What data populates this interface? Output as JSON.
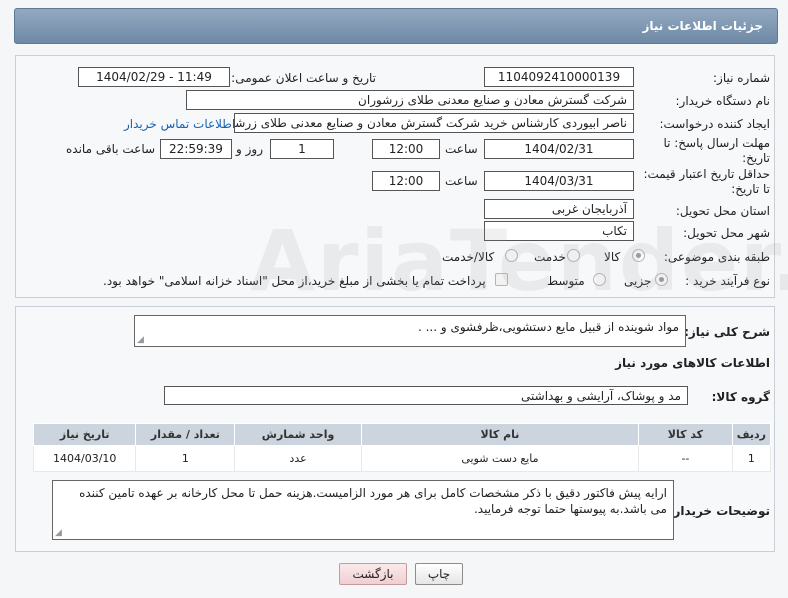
{
  "header": {
    "title": "جزئیات اطلاعات نیاز"
  },
  "need_number": {
    "label": "شماره نیاز:",
    "value": "1104092410000139"
  },
  "announce": {
    "label": "تاریخ و ساعت اعلان عمومی:",
    "value": "1404/02/29 - 11:49"
  },
  "buyer_org": {
    "label": "نام دستگاه خریدار:",
    "value": "شرکت گسترش معادن و صنایع معدنی طلای زرشوران"
  },
  "creator": {
    "label": "ایجاد کننده درخواست:",
    "value": "ناصر  ابیوردی  کارشناس خرید  شرکت گسترش معادن و صنایع معدنی طلای زرشوران",
    "contact_link": "اطلاعات تماس خریدار"
  },
  "reply_deadline": {
    "label_line1": "مهلت ارسال پاسخ: تا",
    "label_line2": "تاریخ:",
    "date": "1404/02/31",
    "time_label": "ساعت",
    "time": "12:00",
    "days": "1",
    "days_label": "روز و",
    "remaining": "22:59:39",
    "remaining_label": "ساعت باقی مانده"
  },
  "price_validity": {
    "label_line1": "حداقل تاریخ اعتبار قیمت:",
    "label_line2": "تا تاریخ:",
    "date": "1404/03/31",
    "time_label": "ساعت",
    "time": "12:00"
  },
  "province": {
    "label": "استان محل تحویل:",
    "value": "آذربایجان غربی"
  },
  "city": {
    "label": "شهر محل تحویل:",
    "value": "تکاب"
  },
  "category": {
    "label": "طبقه بندی موضوعی:",
    "options": [
      "کالا",
      "خدمت",
      "کالا/خدمت"
    ],
    "selected": "کالا"
  },
  "purchase_type": {
    "label": "نوع فرآیند خرید :",
    "options": [
      "جزیی",
      "متوسط"
    ],
    "selected": "جزیی",
    "note": "پرداخت تمام یا بخشی از مبلغ خرید،از محل \"اسناد خزانه اسلامی\" خواهد بود."
  },
  "description": {
    "label": "شرح کلی نیاز:",
    "value": "مواد شوینده از قبیل مایع دستشویی،ظرفشوی و ...  ."
  },
  "goods_section": {
    "title": "اطلاعات کالاهای مورد نیاز"
  },
  "goods_group": {
    "label": "گروه کالا:",
    "value": "مد و پوشاک، آرایشی و بهداشتی"
  },
  "goods_table": {
    "headers": [
      "ردیف",
      "کد کالا",
      "نام کالا",
      "واحد شمارش",
      "تعداد / مقدار",
      "تاریخ نیاز"
    ],
    "rows": [
      [
        "1",
        "--",
        "مایع دست شویی",
        "عدد",
        "1",
        "1404/03/10"
      ]
    ]
  },
  "buyer_notes": {
    "label": "توضیحات خریدار:",
    "value": "ارایه پیش فاکتور دقیق با ذکر مشخصات کامل برای هر مورد الزامیست.هزینه حمل تا محل کارخانه بر عهده تامین کننده می باشد.به پیوستها حتما  توجه فرمایید."
  },
  "buttons": {
    "print": "چاپ",
    "back": "بازگشت"
  },
  "watermark": "AriaTender.neT"
}
